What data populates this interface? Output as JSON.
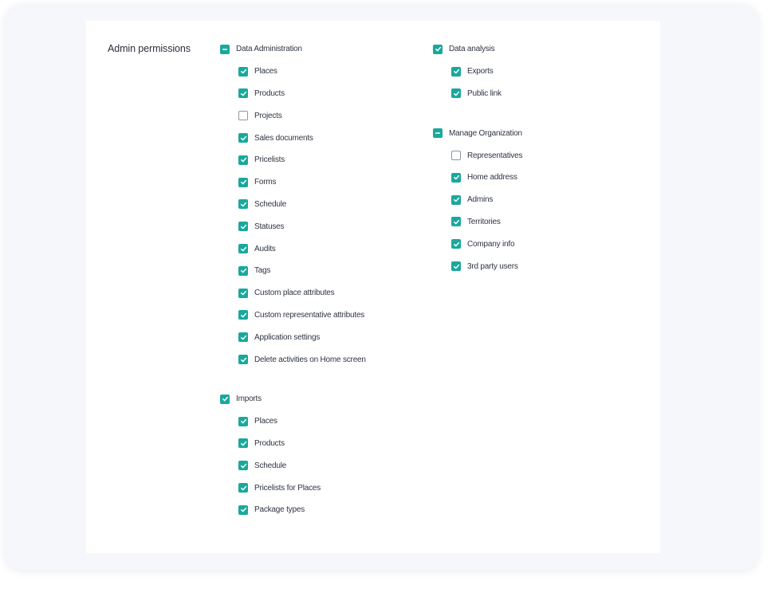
{
  "section_title": "Admin permissions",
  "accent_color": "#1aa89c",
  "columns": [
    {
      "groups": [
        {
          "label": "Data Administration",
          "state": "partial",
          "items": [
            {
              "label": "Places",
              "checked": true
            },
            {
              "label": "Products",
              "checked": true
            },
            {
              "label": "Projects",
              "checked": false
            },
            {
              "label": "Sales documents",
              "checked": true
            },
            {
              "label": "Pricelists",
              "checked": true
            },
            {
              "label": "Forms",
              "checked": true
            },
            {
              "label": "Schedule",
              "checked": true
            },
            {
              "label": "Statuses",
              "checked": true
            },
            {
              "label": "Audits",
              "checked": true
            },
            {
              "label": "Tags",
              "checked": true
            },
            {
              "label": "Custom place attributes",
              "checked": true
            },
            {
              "label": "Custom representative attributes",
              "checked": true
            },
            {
              "label": "Application settings",
              "checked": true
            },
            {
              "label": "Delete activities on Home screen",
              "checked": true
            }
          ]
        },
        {
          "label": "Imports",
          "state": "checked",
          "items": [
            {
              "label": "Places",
              "checked": true
            },
            {
              "label": "Products",
              "checked": true
            },
            {
              "label": "Schedule",
              "checked": true
            },
            {
              "label": "Pricelists for Places",
              "checked": true
            },
            {
              "label": "Package types",
              "checked": true
            }
          ]
        }
      ]
    },
    {
      "groups": [
        {
          "label": "Data analysis",
          "state": "checked",
          "items": [
            {
              "label": "Exports",
              "checked": true
            },
            {
              "label": "Public link",
              "checked": true
            }
          ]
        },
        {
          "label": "Manage Organization",
          "state": "partial",
          "items": [
            {
              "label": "Representatives",
              "checked": false
            },
            {
              "label": "Home address",
              "checked": true
            },
            {
              "label": "Admins",
              "checked": true
            },
            {
              "label": "Territories",
              "checked": true
            },
            {
              "label": "Company info",
              "checked": true
            },
            {
              "label": "3rd party users",
              "checked": true
            }
          ]
        }
      ]
    }
  ]
}
